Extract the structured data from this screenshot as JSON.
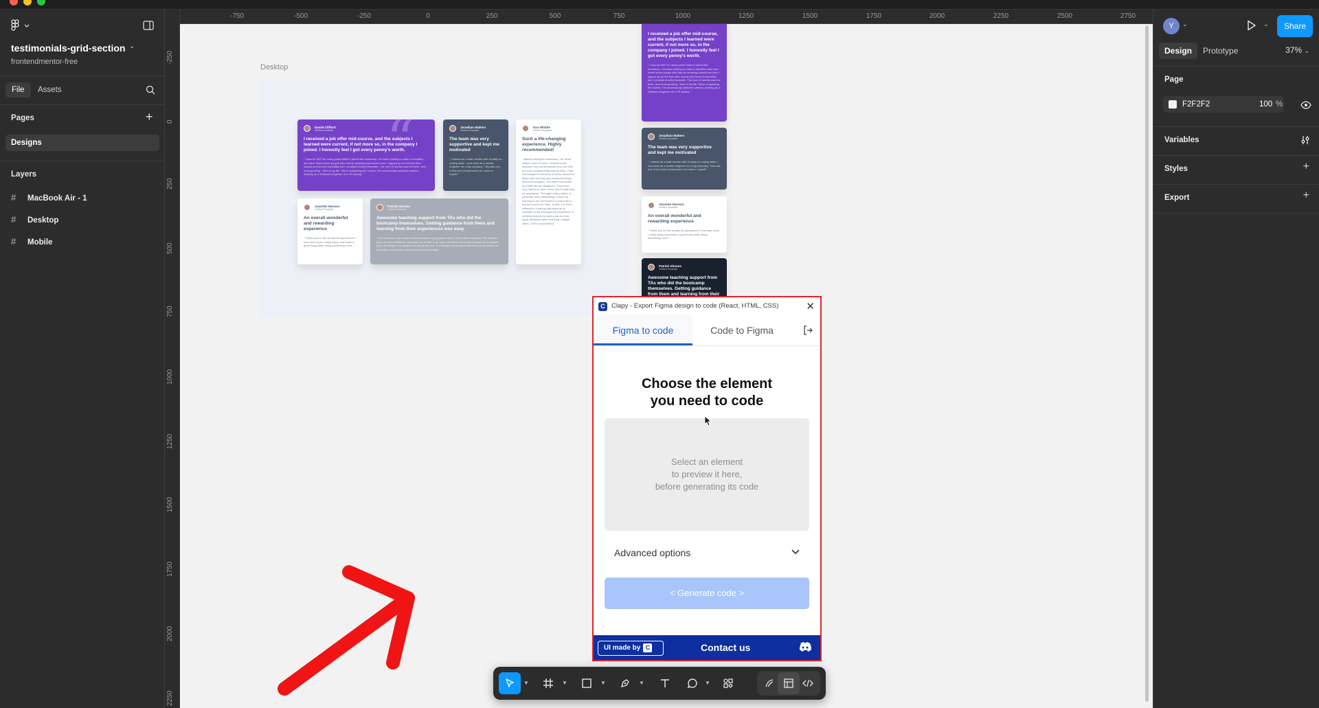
{
  "file": {
    "title": "testimonials-grid-section",
    "project": "frontendmentor-free"
  },
  "left_tabs": {
    "file": "File",
    "assets": "Assets"
  },
  "pages": {
    "heading": "Pages",
    "items": [
      "Designs"
    ]
  },
  "layers": {
    "heading": "Layers",
    "items": [
      "MacBook Air - 1",
      "Desktop",
      "Mobile"
    ]
  },
  "ruler_top": [
    "-750",
    "-500",
    "-250",
    "0",
    "250",
    "500",
    "750",
    "1000",
    "1250",
    "1500",
    "1750",
    "2000",
    "2250",
    "2500",
    "2750"
  ],
  "ruler_left": [
    "-250",
    "0",
    "250",
    "500",
    "750",
    "1000",
    "1250",
    "1500",
    "1750",
    "2000",
    "2250"
  ],
  "canvas": {
    "frame_label": "Desktop",
    "background": "#f2f2f2"
  },
  "cards": {
    "daniel": {
      "name": "Daniel Clifford",
      "role": "Verified Graduate",
      "headline": "I received a job offer mid-course, and the subjects I learned were current, if not more so, in the company I joined. I honestly feel I got every penny's worth.",
      "body": "“ I was an EMT for many years before I joined the bootcamp. I've been looking to make a transition and have heard some people who had an amazing experience here. I signed up for the free intro course and found it incredibly fun! I enrolled shortly thereafter. The next 12 weeks was the best - and most grueling - time of my life. Since completing the course, I've successfully switched careers, working as a Software Engineer at a VR startup. ”"
    },
    "jonathan": {
      "name": "Jonathan Walters",
      "role": "Verified Graduate",
      "headline": "The team was very supportive and kept me motivated",
      "body": "“ I started as a total newbie with virtually no coding skills. I now work as a mobile engineer for a big company. This was one of the best investments I've made in myself. ”"
    },
    "kira": {
      "name": "Kira Whittle",
      "role": "Verified Graduate",
      "headline": "Such a life-changing experience. Highly recommended!",
      "body": "“ Before joining the bootcamp, I've never written a line of code. I needed some structure from professionals who can help me learn programming step by step. I was encouraged to enroll by a former student of theirs who can only say wonderful things about the program. The entire curriculum and staff did not disappoint. They were very hands-on and I never had to wait long for assistance. The agile team project, in particular, was outstanding. It took my learning to the next level in a way that no tutorial could ever have. In fact, I've often referred to it during interviews as an example of my development experience. It certainly helped me land a job as a full-stack developer after receiving multiple offers. 100% recommend! ”"
    },
    "jeanette": {
      "name": "Jeanette Harmon",
      "role": "Verified Graduate",
      "headline": "An overall wonderful and rewarding experience",
      "body": "“ Thank you for the wonderful experience! I now have a job I really enjoy, and make a good living while doing something I love. ”"
    },
    "patrick": {
      "name": "Patrick Abrams",
      "role": "Verified Graduate",
      "headline": "Awesome teaching support from TAs who did the bootcamp themselves. Getting guidance from them and learning from their experiences was easy.",
      "body": "“ The staff seem genuinely concerned about my progress which I find really refreshing. The program gave me the confidence necessary to be able to go out in the world and present myself as a capable junior developer. The standard is above the rest. You will get the personal attention you need from an incredible community of smart and amazing people. ”"
    }
  },
  "plugin": {
    "header": "Clapy - Export Figma design to code (React, HTML, CSS)",
    "tab_active": "Figma to code",
    "tab_inactive": "Code to Figma",
    "title_line1": "Choose the element",
    "title_line2": "you need to code",
    "preview_line1": "Select an element",
    "preview_line2": "to preview it here,",
    "preview_line3": "before generating its code",
    "advanced": "Advanced options",
    "generate": "< Generate code >",
    "made_by": "UI made by",
    "contact": "Contact us"
  },
  "right": {
    "avatar": "Y",
    "share": "Share",
    "tab_design": "Design",
    "tab_prototype": "Prototype",
    "zoom": "37%",
    "page_heading": "Page",
    "page_color": "F2F2F2",
    "page_opacity": "100",
    "page_opacity_unit": "%",
    "variables": "Variables",
    "styles": "Styles",
    "export": "Export"
  },
  "help": "?",
  "colors": {
    "accent": "#0d99ff",
    "plugin_border": "#e0242c",
    "plugin_blue": "#1f5fc9",
    "arrow": "#f01414"
  }
}
